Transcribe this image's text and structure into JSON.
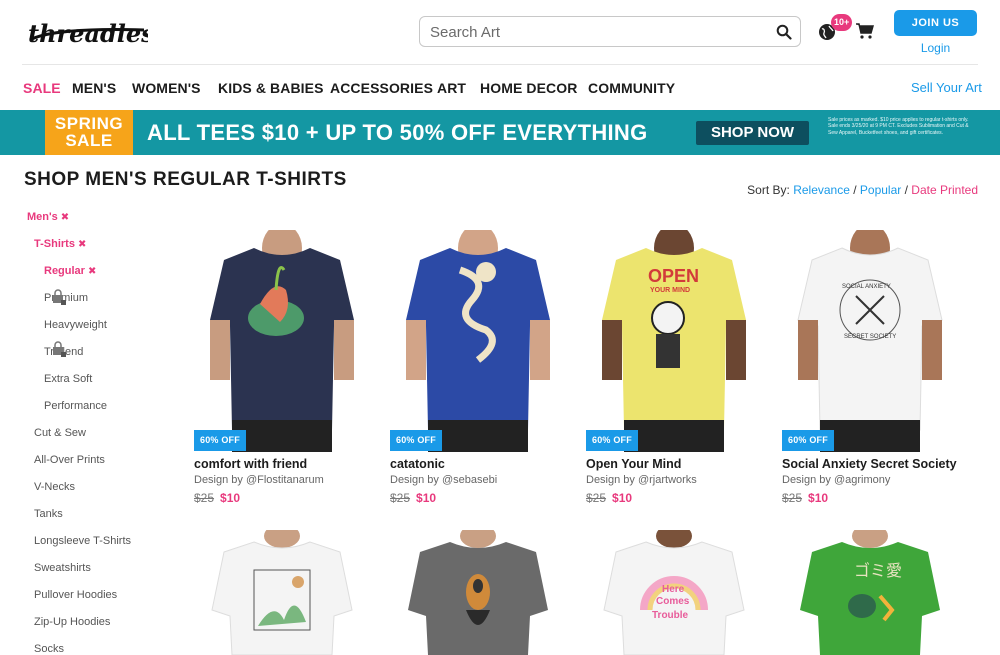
{
  "header": {
    "logo_text": "threadless",
    "search_placeholder": "Search Art",
    "notification_count": "10+",
    "join_label": "JOIN US",
    "login_label": "Login"
  },
  "nav": {
    "items": [
      "SALE",
      "MEN'S",
      "WOMEN'S",
      "KIDS & BABIES",
      "ACCESSORIES",
      "ART",
      "HOME DECOR",
      "COMMUNITY"
    ],
    "sell_label": "Sell Your Art"
  },
  "banner": {
    "spring_line1": "SPRING",
    "spring_line2": "SALE",
    "promo_text": "ALL TEES $10 + UP TO 50% OFF EVERYTHING",
    "shop_now": "SHOP NOW",
    "fine_print": "Sale prices as marked. $10 price applies to regular t-shirts only. Sale ends 3/25/20 at 9 PM CT. Excludes Sublimation and Cut & Sew Apparel, Bucketfeet shoes, and gift certificates."
  },
  "page": {
    "title": "SHOP MEN'S REGULAR T-SHIRTS",
    "sort_label": "Sort By:",
    "sort_options": [
      "Relevance",
      "Popular",
      "Date Printed"
    ],
    "sort_separator": " / "
  },
  "sidebar": {
    "remove_glyph": "✖",
    "items": [
      {
        "label": "Men's"
      },
      {
        "label": "T-Shirts"
      },
      {
        "label": "Regular"
      },
      {
        "label": "Premium"
      },
      {
        "label": "Heavyweight"
      },
      {
        "label": "Triblend"
      },
      {
        "label": "Extra Soft"
      },
      {
        "label": "Performance"
      },
      {
        "label": "Cut & Sew"
      },
      {
        "label": "All-Over Prints"
      },
      {
        "label": "V-Necks"
      },
      {
        "label": "Tanks"
      },
      {
        "label": "Longsleeve T-Shirts"
      },
      {
        "label": "Sweatshirts"
      },
      {
        "label": "Pullover Hoodies"
      },
      {
        "label": "Zip-Up Hoodies"
      },
      {
        "label": "Socks"
      }
    ]
  },
  "products": [
    {
      "title": "comfort with friend",
      "designer": "Design by @Flostitanarum",
      "old_price": "$25",
      "price": "$10",
      "badge": "60% OFF",
      "shirt_color": "#2b3350"
    },
    {
      "title": "catatonic",
      "designer": "Design by @sebasebi",
      "old_price": "$25",
      "price": "$10",
      "badge": "60% OFF",
      "shirt_color": "#2c4aa6"
    },
    {
      "title": "Open Your Mind",
      "designer": "Design by @rjartworks",
      "old_price": "$25",
      "price": "$10",
      "badge": "60% OFF",
      "shirt_color": "#ece46e"
    },
    {
      "title": "Social Anxiety Secret Society",
      "designer": "Design by @agrimony",
      "old_price": "$25",
      "price": "$10",
      "badge": "60% OFF",
      "shirt_color": "#f4f4f4"
    },
    {
      "shirt_color": "#f4f4f4"
    },
    {
      "shirt_color": "#6a6a6a"
    },
    {
      "shirt_color": "#f4f4f4"
    },
    {
      "shirt_color": "#3fa63a"
    }
  ],
  "artwork_text": {
    "open_line1": "OPEN",
    "open_line2": "YOUR MIND",
    "society_top": "SOCIAL ANXIETY",
    "society_bottom": "SECRET SOCIETY",
    "trouble_line1": "Here",
    "trouble_line2": "Comes",
    "trouble_line3": "Trouble"
  },
  "colors": {
    "accent_pink": "#e8397d",
    "accent_blue": "#1a9ae8",
    "banner_teal": "#1497a3",
    "banner_orange": "#f6a41a"
  }
}
